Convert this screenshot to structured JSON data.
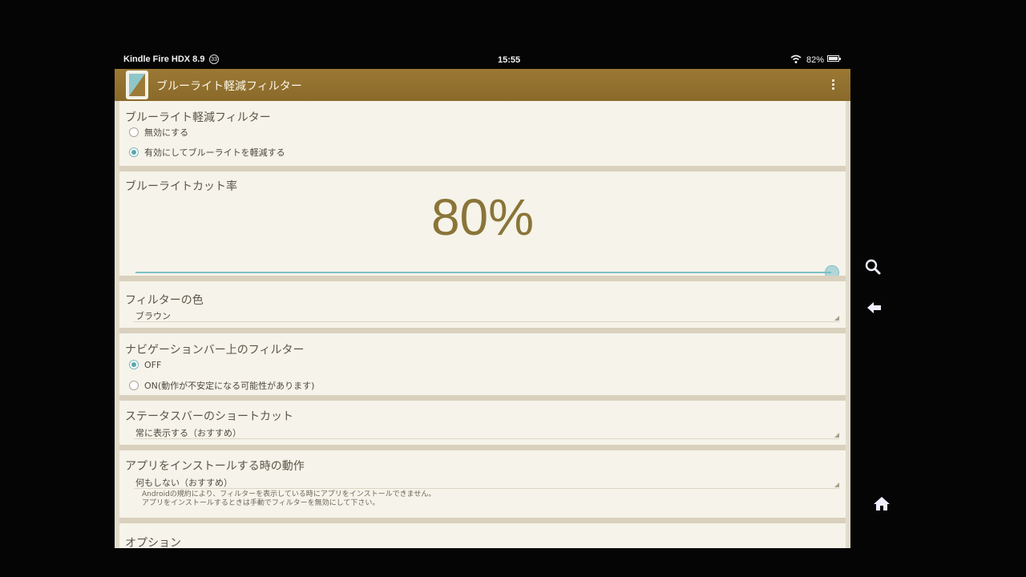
{
  "status_bar": {
    "device": "Kindle Fire HDX 8.9",
    "notification_count": "33",
    "time": "15:55",
    "battery": "82%"
  },
  "app": {
    "title": "ブルーライト軽減フィルター"
  },
  "sections": {
    "filter": {
      "title": "ブルーライト軽減フィルター",
      "options": [
        "無効にする",
        "有効にしてブルーライトを軽減する"
      ],
      "selected_index": 1
    },
    "cut_rate": {
      "title": "ブルーライトカット率",
      "value_label": "80%",
      "slider_fraction": 1.0
    },
    "filter_color": {
      "title": "フィルターの色",
      "value": "ブラウン"
    },
    "navbar_filter": {
      "title": "ナビゲーションバー上のフィルター",
      "options": [
        "OFF",
        "ON(動作が不安定になる可能性があります)"
      ],
      "selected_index": 0
    },
    "statusbar_shortcut": {
      "title": "ステータスバーのショートカット",
      "value": "常に表示する（おすすめ）"
    },
    "install_behavior": {
      "title": "アプリをインストールする時の動作",
      "value": "何もしない（おすすめ）",
      "note_line1": "Androidの規約により、フィルターを表示している時にアプリをインストールできません。",
      "note_line2": "アプリをインストールするときは手動でフィルターを無効にして下さい。"
    },
    "options": {
      "title": "オプション"
    }
  },
  "colors": {
    "action_bar": "#8f6e2c",
    "accent": "#5aa6ad",
    "value_text": "#8a7538"
  },
  "icons": {
    "search": "search-icon",
    "back": "back-arrow-icon",
    "home": "home-icon"
  }
}
